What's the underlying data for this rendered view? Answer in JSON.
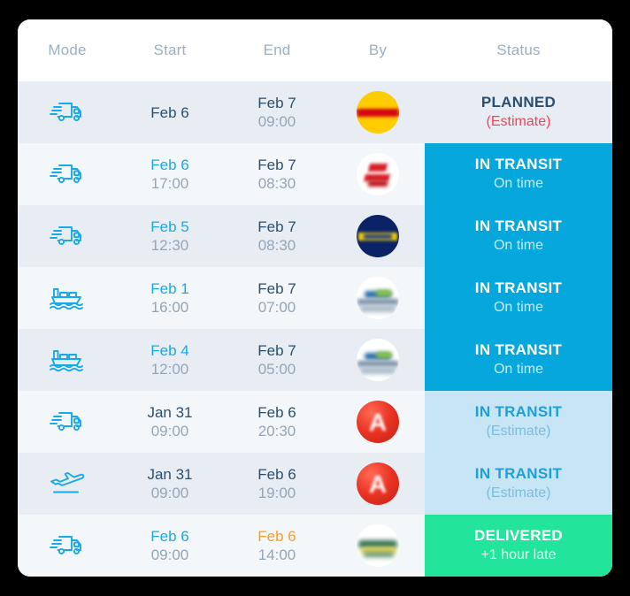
{
  "table": {
    "columns": [
      {
        "key": "mode",
        "label": "Mode"
      },
      {
        "key": "start",
        "label": "Start"
      },
      {
        "key": "end",
        "label": "End"
      },
      {
        "key": "by",
        "label": "By"
      },
      {
        "key": "status",
        "label": "Status"
      }
    ],
    "rows": [
      {
        "mode": "truck-icon",
        "start_date": "Feb 6",
        "start_time": "",
        "end_date": "Feb 7",
        "end_time": "09:00",
        "carrier": "dhl-logo",
        "status_title": "PLANNED",
        "status_sub": "(Estimate)",
        "status_style": "planned"
      },
      {
        "mode": "truck-icon",
        "start_date": "Feb 6",
        "start_time": "17:00",
        "end_date": "Feb 7",
        "end_time": "08:30",
        "carrier": "red-white-logo",
        "status_title": "IN TRANSIT",
        "status_sub": "On time",
        "status_style": "transit"
      },
      {
        "mode": "truck-icon",
        "start_date": "Feb 5",
        "start_time": "12:30",
        "end_date": "Feb 7",
        "end_time": "08:30",
        "carrier": "navy-yellow-logo",
        "status_title": "IN TRANSIT",
        "status_sub": "On time",
        "status_style": "transit"
      },
      {
        "mode": "ship-icon",
        "start_date": "Feb 1",
        "start_time": "16:00",
        "end_date": "Feb 7",
        "end_time": "07:00",
        "carrier": "sea-carrier-logo",
        "status_title": "IN TRANSIT",
        "status_sub": "On time",
        "status_style": "transit"
      },
      {
        "mode": "ship-icon",
        "start_date": "Feb 4",
        "start_time": "12:00",
        "end_date": "Feb 7",
        "end_time": "05:00",
        "carrier": "sea-carrier-logo",
        "status_title": "IN TRANSIT",
        "status_sub": "On time",
        "status_style": "transit"
      },
      {
        "mode": "truck-icon",
        "start_date": "Jan 31",
        "start_time": "09:00",
        "end_date": "Feb 6",
        "end_time": "20:30",
        "carrier": "red-a-logo",
        "status_title": "IN TRANSIT",
        "status_sub": "(Estimate)",
        "status_style": "transit-light"
      },
      {
        "mode": "plane-icon",
        "start_date": "Jan 31",
        "start_time": "09:00",
        "end_date": "Feb 6",
        "end_time": "19:00",
        "carrier": "red-a-logo",
        "status_title": "IN TRANSIT",
        "status_sub": "(Estimate)",
        "status_style": "transit-light"
      },
      {
        "mode": "truck-icon",
        "start_date": "Feb 6",
        "start_time": "09:00",
        "end_date": "Feb 6",
        "end_time": "14:00",
        "carrier": "green-yellow-logo",
        "status_title": "DELIVERED",
        "status_sub": "+1 hour late",
        "status_style": "delivered"
      }
    ]
  },
  "colors": {
    "accent_blue": "#18a9e8",
    "status_transit": "#06a7dd",
    "status_transit_light": "#c8e5f5",
    "status_delivered": "#23e49b",
    "estimate_red": "#f0465a",
    "date_orange": "#f7a026",
    "date_navy": "#2a4f6e",
    "row_shade_a": "#e7edf3",
    "row_shade_b": "#f4f7fa",
    "header_text": "#9bb0c4"
  }
}
